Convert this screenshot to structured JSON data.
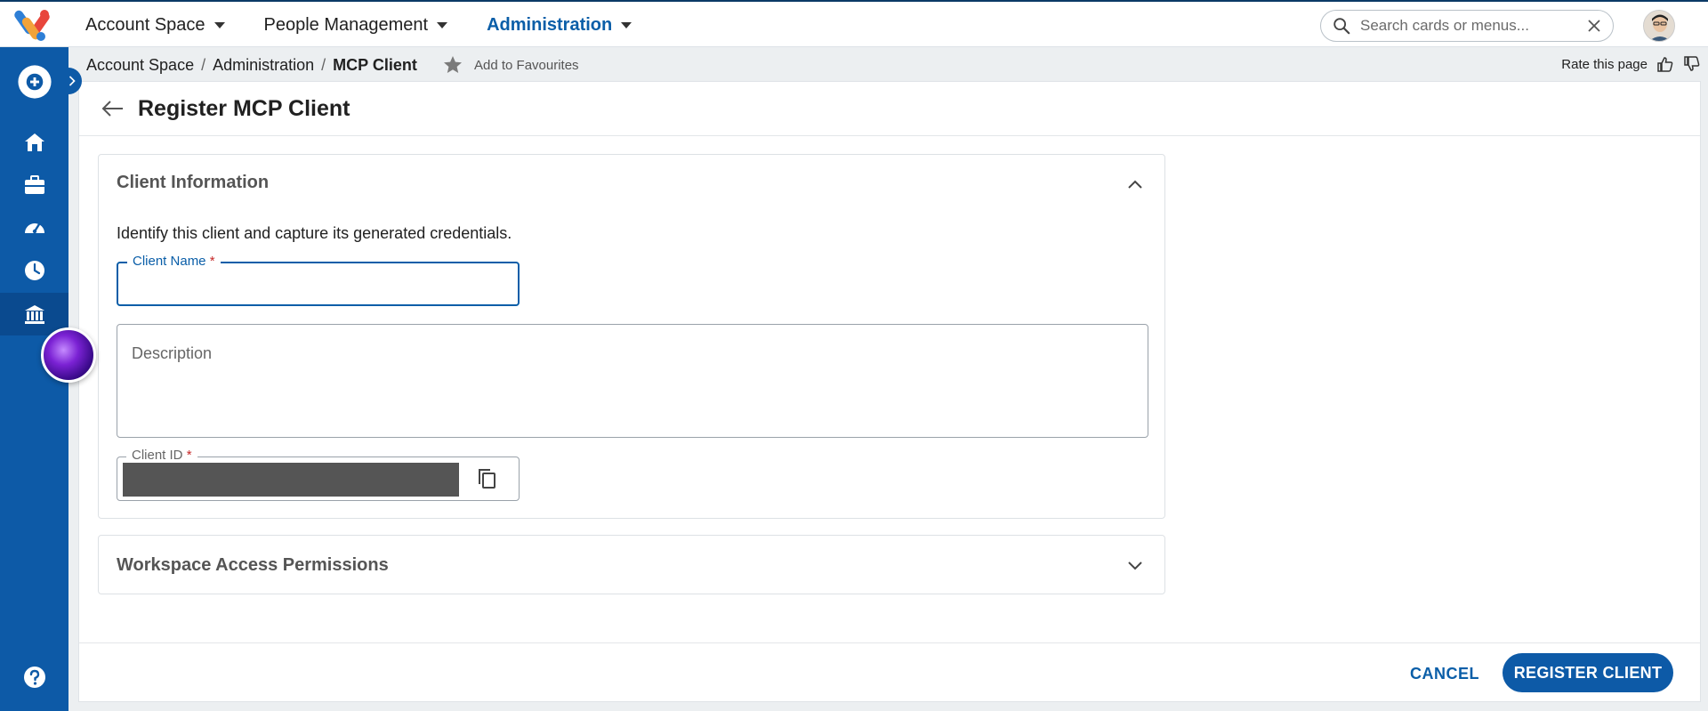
{
  "topnav": {
    "items": [
      {
        "label": "Account Space",
        "active": false
      },
      {
        "label": "People Management",
        "active": false
      },
      {
        "label": "Administration",
        "active": true
      }
    ],
    "search_placeholder": "Search cards or menus..."
  },
  "breadcrumb": {
    "items": [
      "Account Space",
      "Administration"
    ],
    "current": "MCP Client",
    "separator": "/",
    "favourite_label": "Add to Favourites",
    "rate_label": "Rate this page"
  },
  "page": {
    "title": "Register MCP Client"
  },
  "client_info": {
    "title": "Client Information",
    "description": "Identify this client and capture its generated credentials.",
    "client_name_label": "Client Name",
    "client_name_value": "",
    "required_mark": "*",
    "description_placeholder": "Description",
    "client_id_label": "Client ID"
  },
  "permissions": {
    "title": "Workspace Access Permissions"
  },
  "footer": {
    "cancel_label": "CANCEL",
    "register_label": "REGISTER CLIENT"
  },
  "colors": {
    "brand": "#0d5aa7",
    "active_nav": "#0a5ea8",
    "required": "#c62828"
  },
  "icons": [
    "app-logo-icon",
    "chevron-down-icon",
    "search-icon",
    "close-icon",
    "plus-circle-icon",
    "home-icon",
    "briefcase-icon",
    "dashboard-icon",
    "clock-icon",
    "bank-icon",
    "help-icon",
    "star-icon",
    "thumbs-up-icon",
    "thumbs-down-icon",
    "arrow-left-icon",
    "chevron-up-icon",
    "copy-icon"
  ]
}
